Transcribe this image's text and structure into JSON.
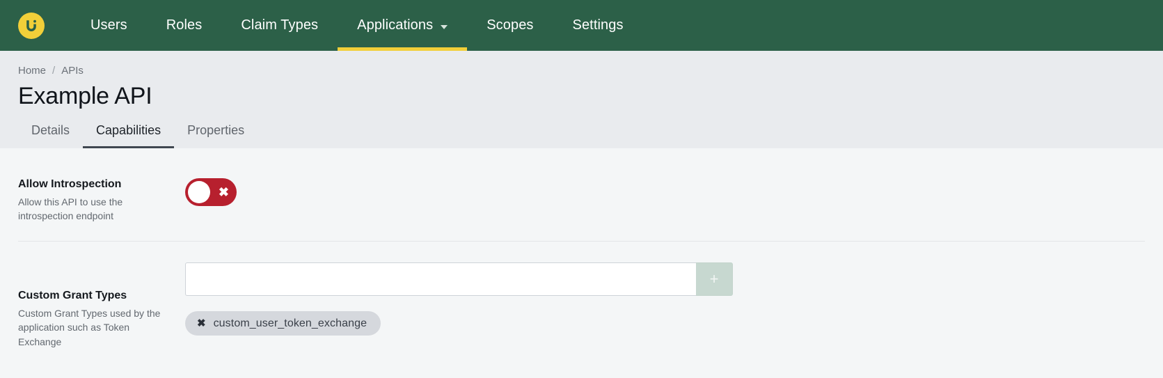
{
  "topnav": {
    "logo_name": "brand-logo-u",
    "logo_colors": {
      "circle": "#f2cf39",
      "glyph": "#2c6048"
    },
    "background": "#2c6048",
    "active_indicator_color": "#f2cf39",
    "items": [
      {
        "label": "Users",
        "active": false,
        "has_caret": false
      },
      {
        "label": "Roles",
        "active": false,
        "has_caret": false
      },
      {
        "label": "Claim Types",
        "active": false,
        "has_caret": false
      },
      {
        "label": "Applications",
        "active": true,
        "has_caret": true
      },
      {
        "label": "Scopes",
        "active": false,
        "has_caret": false
      },
      {
        "label": "Settings",
        "active": false,
        "has_caret": false
      }
    ]
  },
  "header": {
    "breadcrumb": [
      {
        "label": "Home"
      },
      {
        "label": "APIs"
      }
    ],
    "breadcrumb_separator": "/",
    "title": "Example API",
    "tabs": [
      {
        "label": "Details",
        "active": false
      },
      {
        "label": "Capabilities",
        "active": true
      },
      {
        "label": "Properties",
        "active": false
      }
    ]
  },
  "main": {
    "introspection": {
      "title": "Allow Introspection",
      "description": "Allow this API to use the introspection endpoint",
      "toggle": {
        "state": "off",
        "icon": "close-x-icon",
        "glyph": "✖",
        "track_color": "#b7202e",
        "knob_color": "#ffffff"
      }
    },
    "grant_types": {
      "title": "Custom Grant Types",
      "description": "Custom Grant Types used by the application such as Token Exchange",
      "input_value": "",
      "input_placeholder": "",
      "add_button": {
        "label": "+",
        "icon": "plus-icon",
        "color": "#c7d8d0"
      },
      "chips": [
        {
          "label": "custom_user_token_exchange",
          "remove_icon": "close-x-icon",
          "remove_glyph": "✖"
        }
      ]
    }
  }
}
